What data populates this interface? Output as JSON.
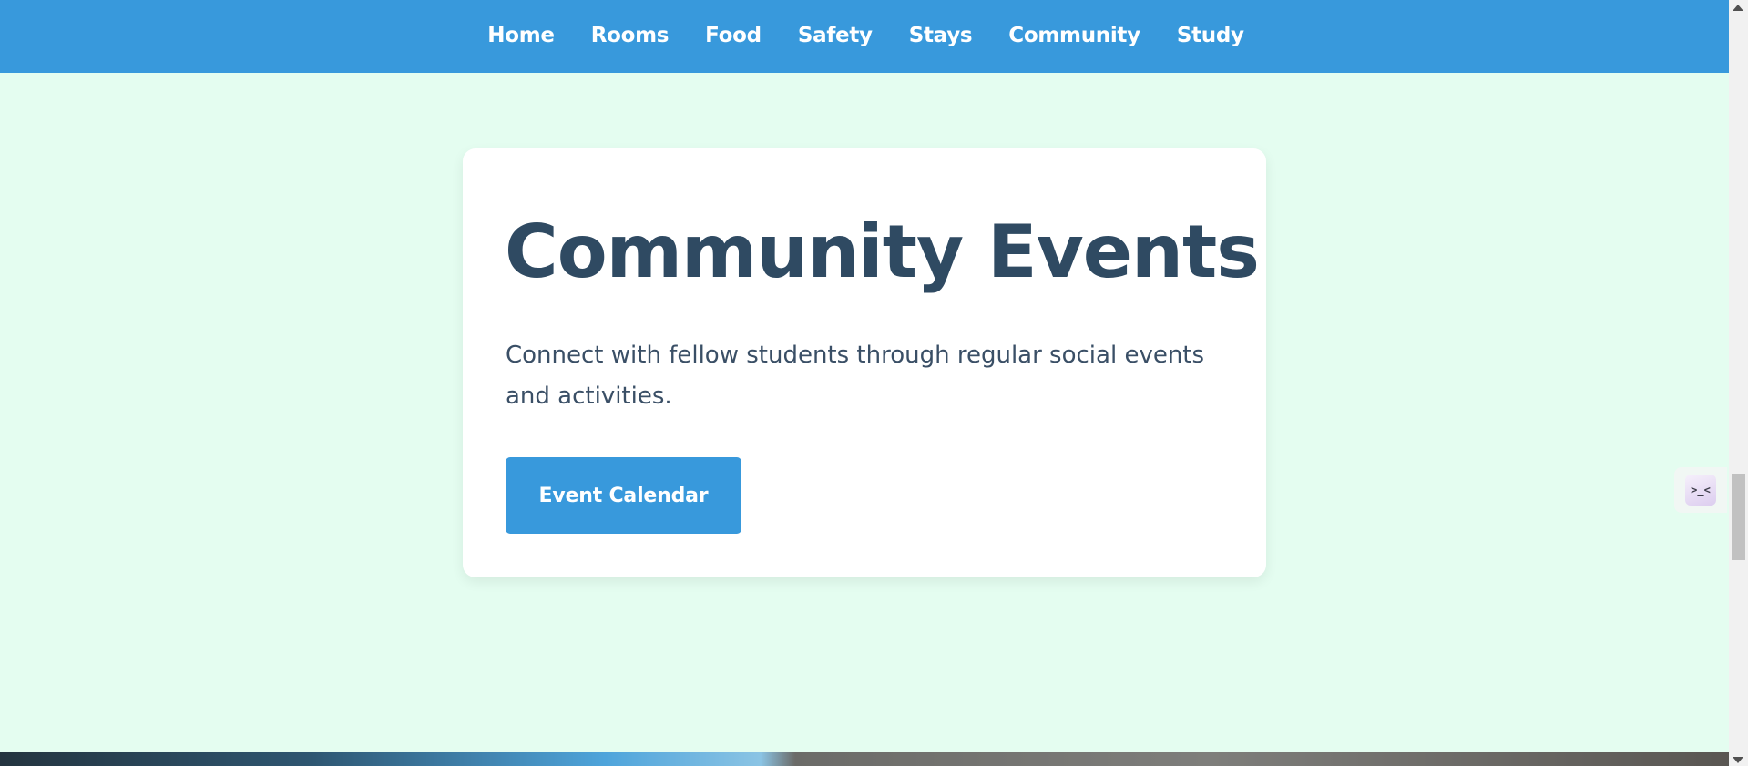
{
  "nav": {
    "items": [
      {
        "label": "Home"
      },
      {
        "label": "Rooms"
      },
      {
        "label": "Food"
      },
      {
        "label": "Safety"
      },
      {
        "label": "Stays"
      },
      {
        "label": "Community"
      },
      {
        "label": "Study"
      }
    ]
  },
  "card": {
    "title": "Community Events",
    "description": "Connect with fellow students through regular social events and activities.",
    "button_label": "Event Calendar"
  },
  "widget": {
    "icon": "terminal-face-icon",
    "glyph": ">_<"
  },
  "colors": {
    "nav_background": "#3899dc",
    "page_background": "#e4fdf0",
    "card_background": "#ffffff",
    "title_text": "#2f4a62",
    "button_background": "#3899dc",
    "button_text": "#ffffff"
  }
}
